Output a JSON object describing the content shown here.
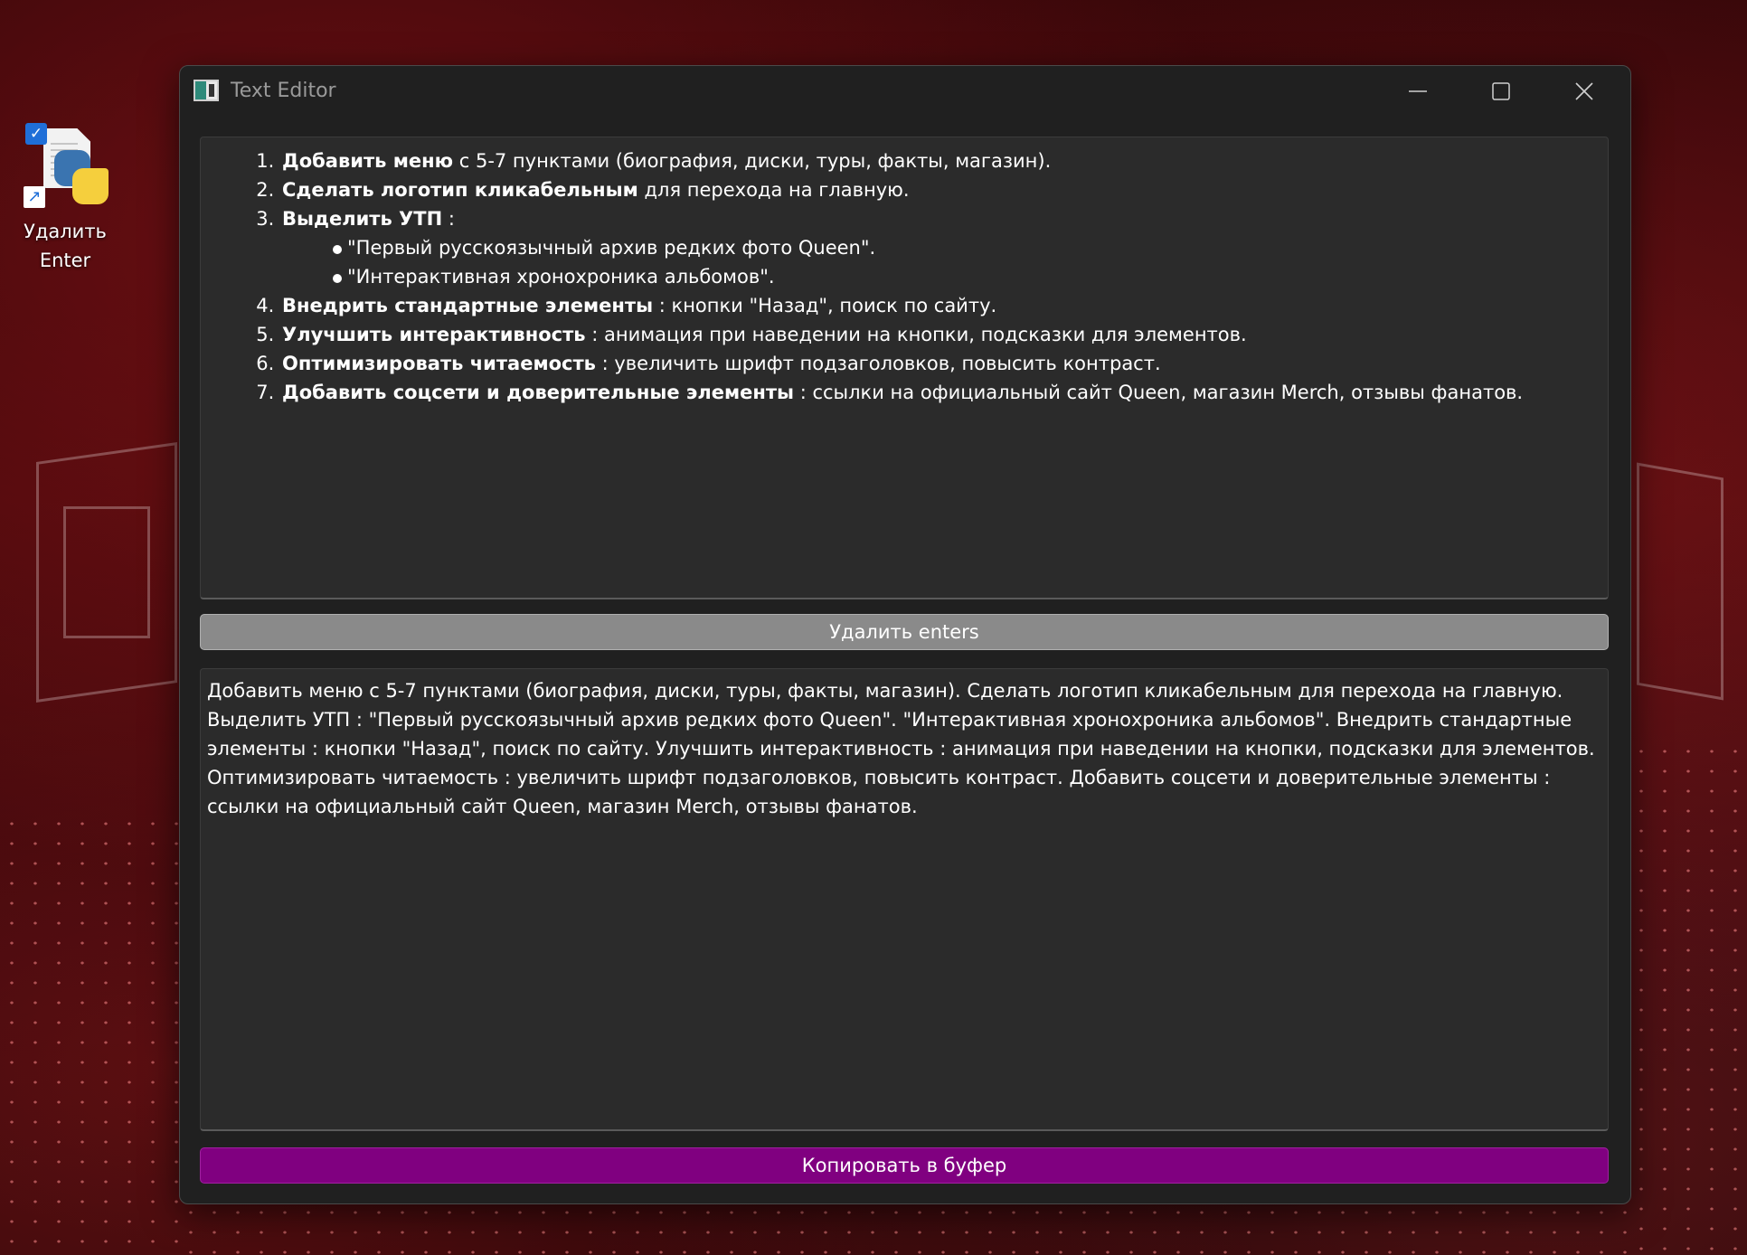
{
  "desktop": {
    "shortcut": {
      "icon": "python-file-icon",
      "label_line1": "Удалить",
      "label_line2": "Enter"
    }
  },
  "window": {
    "title": "Text Editor",
    "controls": {
      "minimize": "minimize-icon",
      "maximize": "maximize-icon",
      "close": "close-icon"
    }
  },
  "input": {
    "items": [
      {
        "bold": "Добавить меню",
        "rest": " с 5-7 пунктами (биография, диски, туры, факты, магазин)."
      },
      {
        "bold": "Сделать логотип кликабельным",
        "rest": " для перехода на главную."
      },
      {
        "bold": "Выделить УТП",
        "rest": " :"
      },
      {
        "bold": "Внедрить стандартные элементы",
        "rest": " : кнопки \"Назад\", поиск по сайту."
      },
      {
        "bold": "Улучшить интерактивность",
        "rest": " : анимация при наведении на кнопки, подсказки для элементов."
      },
      {
        "bold": "Оптимизировать читаемость",
        "rest": " : увеличить шрифт подзаголовков, повысить контраст."
      },
      {
        "bold": "Добавить соцсети и доверительные элементы",
        "rest": " : ссылки на официальный сайт Queen, магазин Merch, отзывы фанатов."
      }
    ],
    "subitems": [
      "\"Первый русскоязычный архив редких фото Queen\".",
      "\"Интерактивная хронохроника альбомов\"."
    ]
  },
  "buttons": {
    "remove_enters": "Удалить enters",
    "copy": "Копировать в буфер"
  },
  "output": {
    "text": "Добавить меню с 5-7 пунктами (биография, диски, туры, факты, магазин). Сделать логотип кликабельным для перехода на главную. Выделить УТП : \"Первый русскоязычный архив редких фото Queen\". \"Интерактивная хронохроника альбомов\". Внедрить стандартные элементы : кнопки \"Назад\", поиск по сайту. Улучшить интерактивность : анимация при наведении на кнопки, подсказки для элементов. Оптимизировать читаемость : увеличить шрифт подзаголовков, повысить контраст. Добавить соцсети и доверительные элементы : ссылки на официальный сайт Queen, магазин Merch, отзывы фанатов."
  },
  "colors": {
    "window_bg": "#202020",
    "pane_bg": "#2b2b2b",
    "remove_button": "#8a8a8a",
    "copy_button": "#800080"
  }
}
